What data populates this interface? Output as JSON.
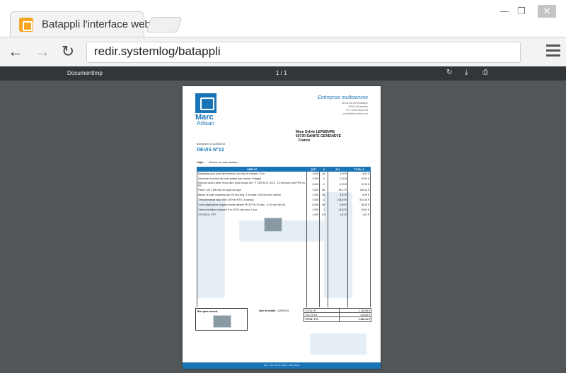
{
  "browser": {
    "tab_title": "Batappli l'interface web",
    "url": "redir.systemlog/batappli",
    "window_controls": {
      "minimize": "—",
      "maximize": "❐",
      "close": "✕"
    },
    "nav": {
      "back": "←",
      "forward": "→",
      "reload": "↻"
    }
  },
  "viewer": {
    "doc_name": "DocumentImp",
    "page_indicator": "1 / 1",
    "icons": [
      "rotate-icon",
      "download-icon",
      "print-icon"
    ]
  },
  "document": {
    "brand_line1": "Marc",
    "brand_line2": "Artisan",
    "company_name": "Entreprise multiservice",
    "company_lines": [
      "28 rue de la République",
      "34000 Montpellier",
      "Tél : 06 44 66 64 55",
      "contact@monmail.com"
    ],
    "client_lines": [
      "Mme Sylvie LEFEBVRE",
      "60730 SAINTE GENEVIEVE",
      "France"
    ],
    "date_line": "Montpellier, le 12/08/2015",
    "devis_title": "DEVIS N°12",
    "objet_label": "Objet :",
    "objet_value": "Peinture de votre sanitaire",
    "table": {
      "headers": [
        "LIBELLE",
        "QTE",
        "U",
        "P.U.",
        "TOTAL €"
      ],
      "rows": [
        {
          "label": "Majoration pour pose des carreaux de sols en surface < 5 m²",
          "qty": "3,000",
          "unit": "M²",
          "pu": "3,00 €",
          "total": "9,00 €"
        },
        {
          "label": "Descente d'ouvrant de porte palière (par hauteur d'étage)",
          "qty": "2,000",
          "unit": "U",
          "pu": "7,50 €",
          "total": "15,00 €"
        },
        {
          "label": "Raccord droit à sertir, écrou libre, joint torique (réf : P 7309 D) D. M 22 - 16 mm pour tube PER ou PB",
          "qty": "2,000",
          "unit": "U",
          "pu": "6,15 €",
          "total": "12,30 €"
        },
        {
          "label": "Panne 140 x 280 mm en sapin de pays",
          "qty": "3,000",
          "unit": "ML",
          "pu": "45,47 €",
          "total": "136,41 €"
        },
        {
          "label": "Bande de solin suspendu dév 90 mm long. 2 m épais. 0,65 mm zinc naturel",
          "qty": "1,000",
          "unit": "ML",
          "pu": "8,99 €",
          "total": "8,99 €"
        },
        {
          "label": "Télécommande radio Telis 16 Pure RTS 16 canaux",
          "qty": "4,000",
          "unit": "U",
          "pu": "218,54 €",
          "total": "874,16 €"
        },
        {
          "label": "Tube polyéthylène irrigation haute densité PE 80 PN 10 bars - D. 40 mm (50 m)",
          "qty": "5,000",
          "unit": "ML",
          "pu": "5,69 €",
          "total": "28,45 €"
        },
        {
          "label": "Gaine ventilateur longueur 5 m Ø 300 mm pour 1 jour",
          "qty": "2,000",
          "unit": "J",
          "pu": "14,82 €",
          "total": "29,64 €"
        },
        {
          "label": "CEGESOL STR",
          "qty": "1,000",
          "unit": "KG",
          "pu": "1,61 €",
          "total": "1,61 €"
        }
      ]
    },
    "bon_pour_accord": "Bon pour accord,",
    "date_validite_label": "Date de validité :",
    "date_validite_value": "12/09/2015",
    "totals": [
      {
        "label": "TOTAL HT",
        "value": "1 115,56 €"
      },
      {
        "label": "TVA 19,6%",
        "value": "218,65 €"
      },
      {
        "label": "TOTAL TTC",
        "value": "1 334,21 €"
      }
    ],
    "footer": "Siret : 451 228 521 0000 - APE 0012A"
  }
}
